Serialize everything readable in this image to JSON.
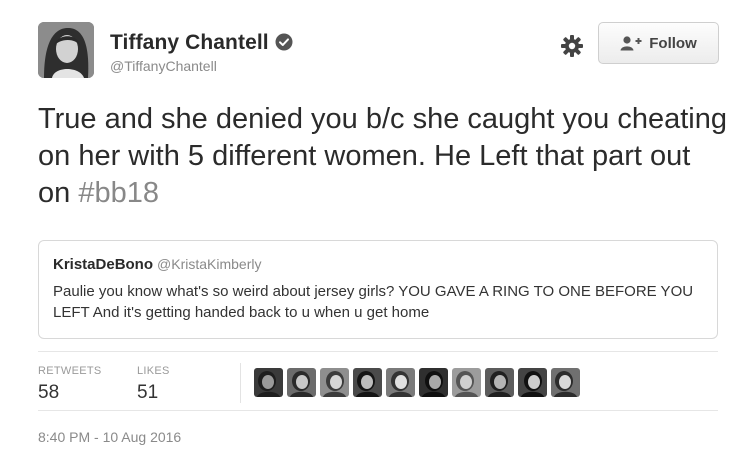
{
  "author": {
    "display_name": "Tiffany Chantell",
    "handle": "@TiffanyChantell",
    "verified": true,
    "avatar": "woman-portrait-photo"
  },
  "actions": {
    "settings_icon": "gear-icon",
    "follow_label": "Follow",
    "follow_icon": "add-user-icon"
  },
  "tweet": {
    "text_before_hashtag": "True and she denied you b/c she caught you cheating on her with 5 different women. He Left that part out on ",
    "hashtag": "#bb18"
  },
  "quoted_tweet": {
    "display_name": "KristaDeBono",
    "handle": "@KristaKimberly",
    "text": "Paulie you know what's so weird about jersey girls? YOU GAVE A RING TO ONE BEFORE YOU LEFT And it's getting handed back to u when u get home"
  },
  "stats": {
    "retweets_label": "RETWEETS",
    "retweets_value": "58",
    "likes_label": "LIKES",
    "likes_value": "51",
    "liker_avatars": [
      "liker-avatar",
      "liker-avatar",
      "liker-avatar",
      "liker-avatar",
      "liker-avatar",
      "liker-avatar",
      "liker-avatar",
      "liker-avatar",
      "liker-avatar",
      "liker-avatar"
    ]
  },
  "timestamp": "8:40 PM - 10 Aug 2016",
  "colors": {
    "text": "#2b2b2b",
    "secondary_text": "#8a8a8a",
    "border": "#d8d8d8"
  }
}
